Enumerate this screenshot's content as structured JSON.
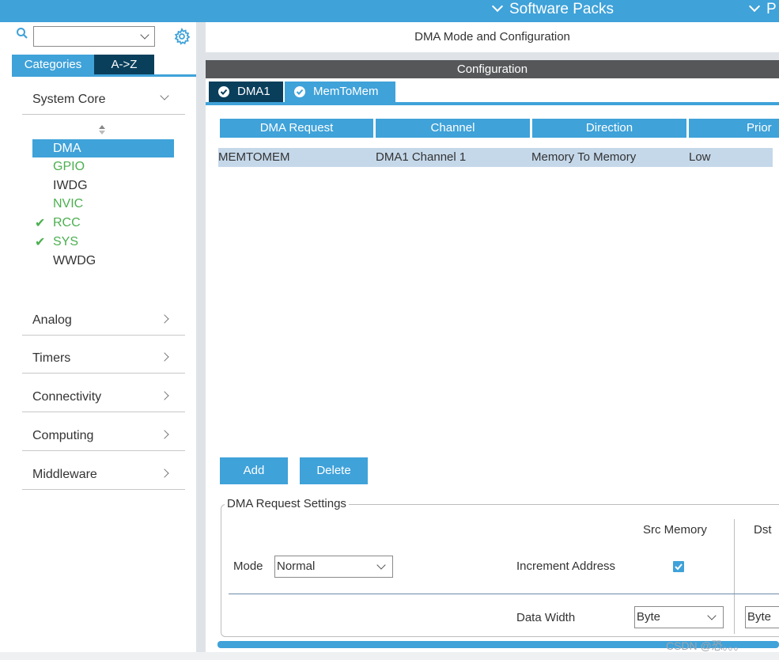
{
  "topbar": {
    "software_packs": "Software Packs",
    "next_menu": "P"
  },
  "left": {
    "search": {
      "value": "",
      "placeholder": ""
    },
    "tabs": {
      "categories": "Categories",
      "az": "A->Z"
    },
    "categories": [
      {
        "label": "System Core",
        "expanded": true
      },
      {
        "label": "Analog"
      },
      {
        "label": "Timers"
      },
      {
        "label": "Connectivity"
      },
      {
        "label": "Computing"
      },
      {
        "label": "Middleware"
      }
    ],
    "system_core_items": [
      {
        "label": "DMA",
        "state": "selected"
      },
      {
        "label": "GPIO",
        "state": "green"
      },
      {
        "label": "IWDG",
        "state": "plain"
      },
      {
        "label": "NVIC",
        "state": "green"
      },
      {
        "label": "RCC",
        "state": "checked"
      },
      {
        "label": "SYS",
        "state": "checked"
      },
      {
        "label": "WWDG",
        "state": "plain"
      }
    ]
  },
  "right": {
    "title": "DMA Mode and Configuration",
    "config_bar": "Configuration",
    "tabs": {
      "dma1": "DMA1",
      "memtomem": "MemToMem"
    },
    "table": {
      "headers": [
        "DMA Request",
        "Channel",
        "Direction",
        "Prior"
      ],
      "rows": [
        [
          "MEMTOMEM",
          "DMA1 Channel 1",
          "Memory To Memory",
          "Low"
        ]
      ]
    },
    "buttons": {
      "add": "Add",
      "delete": "Delete"
    },
    "settings": {
      "legend": "DMA Request Settings",
      "src_memory": "Src Memory",
      "dst": "Dst",
      "mode_label": "Mode",
      "mode_value": "Normal",
      "increment_address": "Increment Address",
      "increment_checked": true,
      "data_width": "Data Width",
      "src_data_width": "Byte",
      "dst_data_width": "Byte"
    }
  },
  "watermark": "CSDN @恐。。。",
  "colors": {
    "accent": "#3fa2d9",
    "dark_tab": "#0a3f5c",
    "config_bar": "#555759",
    "row_selected": "#c5d8ea",
    "ok_green": "#4caf50"
  }
}
